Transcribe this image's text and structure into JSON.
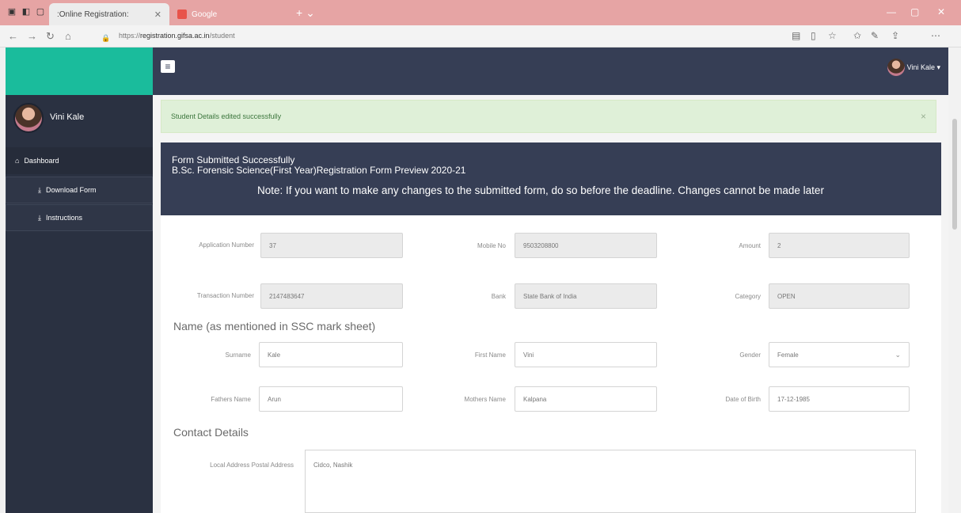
{
  "browser": {
    "tabs": [
      {
        "label": ":Online Registration:",
        "active": true
      },
      {
        "label": "Google",
        "active": false
      }
    ],
    "url_prefix": "https://",
    "url_domain": "registration.gifsa.ac.in",
    "url_path": "/student"
  },
  "app": {
    "accent_color": "#1abc9c",
    "navy_color": "#363e55",
    "user_name": "Vini Kale",
    "topbar_user": "Vini Kale ▾"
  },
  "sidebar": {
    "items": [
      {
        "label": "Dashboard",
        "icon": "home-icon"
      },
      {
        "label": "Download Form",
        "icon": "download-icon"
      },
      {
        "label": "Instructions",
        "icon": "download-icon"
      }
    ]
  },
  "alert": {
    "text": "Student Details edited successfully",
    "close": "×"
  },
  "panel": {
    "line1": "Form Submitted Successfully",
    "line2": "B.Sc. Forensic Science(First Year)Registration Form Preview 2020-21",
    "note": "Note: If you want to make any changes to the submitted form, do so before the deadline. Changes cannot be made later"
  },
  "form": {
    "application_number": {
      "label": "Application Number",
      "value": "37"
    },
    "mobile_no": {
      "label": "Mobile No",
      "value": "9503208800"
    },
    "amount": {
      "label": "Amount",
      "value": "2"
    },
    "transaction_number": {
      "label": "Transaction Number",
      "value": "2147483647"
    },
    "bank": {
      "label": "Bank",
      "value": "State Bank of India"
    },
    "category": {
      "label": "Category",
      "value": "OPEN"
    },
    "name_section": "Name (as mentioned in SSC mark sheet)",
    "surname": {
      "label": "Surname",
      "value": "Kale"
    },
    "first_name": {
      "label": "First Name",
      "value": "Vini"
    },
    "gender": {
      "label": "Gender",
      "value": "Female"
    },
    "fathers_name": {
      "label": "Fathers Name",
      "value": "Arun"
    },
    "mothers_name": {
      "label": "Mothers Name",
      "value": "Kalpana"
    },
    "dob": {
      "label": "Date of Birth",
      "value": "17-12-1985"
    },
    "contact_section": "Contact Details",
    "local_address": {
      "label": "Local Address Postal Address",
      "value": "Cidco, Nashik"
    }
  }
}
